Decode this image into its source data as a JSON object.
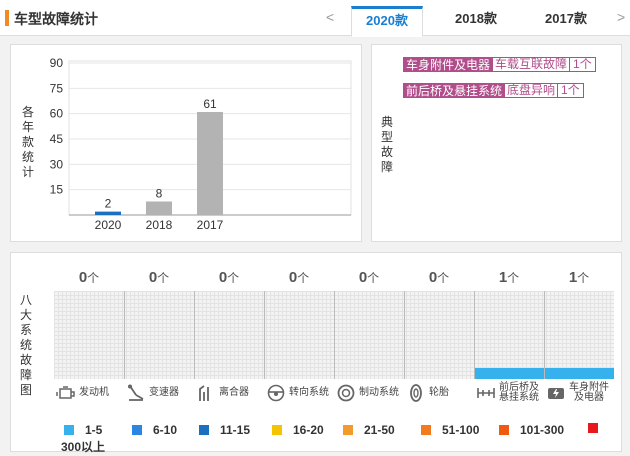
{
  "header": {
    "title": "车型故障统计",
    "prev_arrow": "<",
    "next_arrow": ">",
    "tabs": [
      {
        "label": "2020款",
        "active": true
      },
      {
        "label": "2018款",
        "active": false
      },
      {
        "label": "2017款",
        "active": false
      }
    ]
  },
  "yearly_panel": {
    "side_label": "各年款统计"
  },
  "chart_data": {
    "type": "bar",
    "categories": [
      "2020",
      "2018",
      "2017"
    ],
    "values": [
      2,
      8,
      61
    ],
    "yticks": [
      15,
      30,
      45,
      60,
      75,
      90
    ],
    "ylim": [
      0,
      90
    ],
    "bar_colors": [
      "#1a6fbf",
      "#b3b3b3",
      "#b3b3b3"
    ],
    "grid": true
  },
  "typical_panel": {
    "side_label": "典型故障",
    "faults": [
      {
        "category": "车身附件及电器",
        "item": "车载互联故障",
        "count": "1个"
      },
      {
        "category": "前后桥及悬挂系统",
        "item": "底盘异响",
        "count": "1个"
      }
    ]
  },
  "systems_panel": {
    "side_label": "八大系统故障图",
    "unit": "个",
    "systems": [
      {
        "name": "发动机",
        "icon": "engine-icon",
        "count": "0",
        "level": 0
      },
      {
        "name": "变速器",
        "icon": "gearbox-icon",
        "count": "0",
        "level": 0
      },
      {
        "name": "离合器",
        "icon": "clutch-icon",
        "count": "0",
        "level": 0
      },
      {
        "name": "转向系统",
        "icon": "steering-wheel-icon",
        "count": "0",
        "level": 0
      },
      {
        "name": "制动系统",
        "icon": "brake-disc-icon",
        "count": "0",
        "level": 0
      },
      {
        "name": "轮胎",
        "icon": "tire-icon",
        "count": "0",
        "level": 0
      },
      {
        "name": "前后桥及悬挂系统",
        "name_lines": [
          "前后桥及",
          "悬挂系统"
        ],
        "icon": "suspension-icon",
        "count": "1",
        "level": 1
      },
      {
        "name": "车身附件及电器",
        "name_lines": [
          "车身附件",
          "及电器"
        ],
        "icon": "body-electrical-icon",
        "count": "1",
        "level": 1
      }
    ],
    "legend": [
      {
        "label": "1-5",
        "color": "#35b2ee"
      },
      {
        "label": "6-10",
        "color": "#2a86e0"
      },
      {
        "label": "11-15",
        "color": "#1a6fbf"
      },
      {
        "label": "16-20",
        "color": "#f5c400"
      },
      {
        "label": "21-50",
        "color": "#f39a2c"
      },
      {
        "label": "51-100",
        "color": "#f47a20"
      },
      {
        "label": "101-300",
        "color": "#f05a10"
      },
      {
        "label": "300以上",
        "color": "#e8191c"
      }
    ]
  }
}
